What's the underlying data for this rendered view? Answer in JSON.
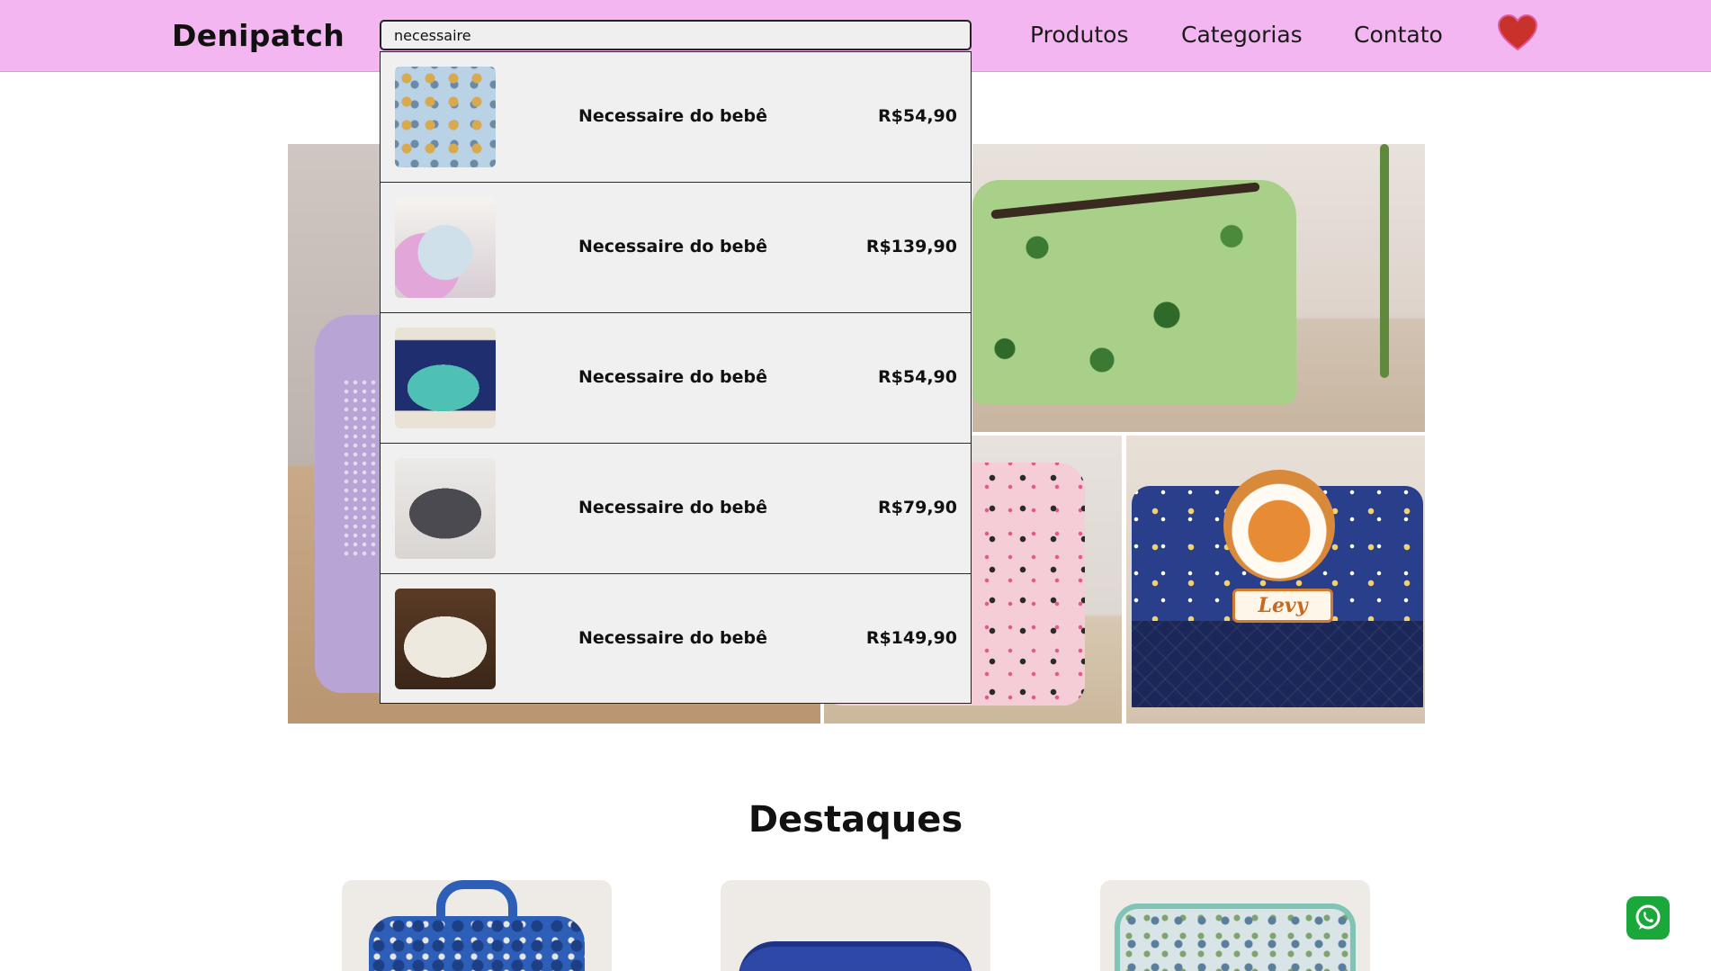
{
  "header": {
    "logo": "Denipatch",
    "search_value": "necessaire",
    "nav": [
      "Produtos",
      "Categorias",
      "Contato"
    ],
    "favorites_icon": "heart-icon",
    "colors": {
      "header_bg": "#f4b6f1",
      "heart": "#c8322a"
    }
  },
  "search_results": [
    {
      "name": "Necessaire do bebê",
      "price": "R$54,90"
    },
    {
      "name": "Necessaire do bebê",
      "price": "R$139,90"
    },
    {
      "name": "Necessaire do bebê",
      "price": "R$54,90"
    },
    {
      "name": "Necessaire do bebê",
      "price": "R$79,90"
    },
    {
      "name": "Necessaire do bebê",
      "price": "R$149,90"
    }
  ],
  "gallery": {
    "blue_tile_name_tag": "Levy"
  },
  "featured": {
    "title": "Destaques"
  },
  "chat": {
    "icon": "whatsapp-icon",
    "color": "#1aa83b"
  }
}
